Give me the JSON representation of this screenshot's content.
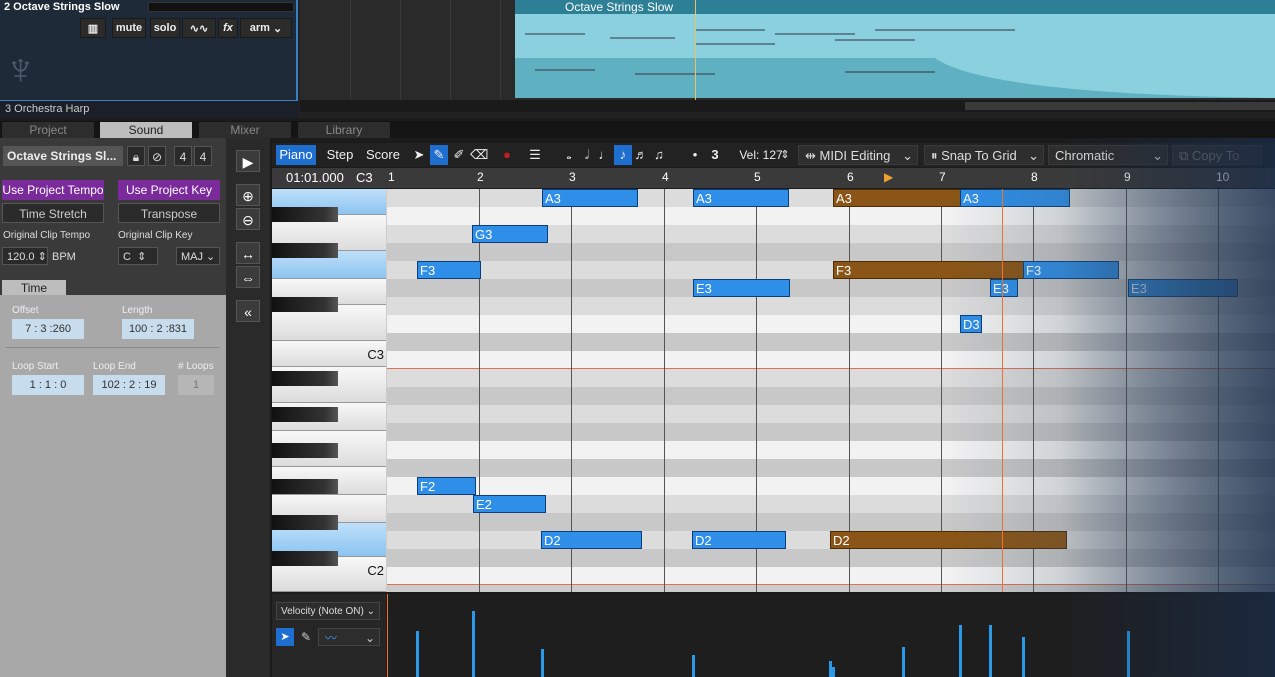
{
  "track2": {
    "name": "2 Octave Strings Slow",
    "buttons": [
      "mute",
      "solo",
      "fx",
      "arm"
    ]
  },
  "track3": {
    "name": "3 Orchestra Harp"
  },
  "clip": {
    "name": "Octave Strings Slow"
  },
  "tabs": [
    "Project",
    "Sound",
    "Mixer",
    "Library"
  ],
  "active_tab": "Sound",
  "left": {
    "clip_name": "Octave Strings Sl...",
    "time_sig_num": "4",
    "time_sig_den": "4",
    "use_project_tempo": "Use Project Tempo",
    "use_project_key": "Use Project Key",
    "time_stretch": "Time Stretch",
    "transpose": "Transpose",
    "orig_tempo_label": "Original Clip Tempo",
    "orig_key_label": "Original Clip Key",
    "tempo_value": "120.0",
    "bpm": "BPM",
    "key_value": "C",
    "mode_value": "MAJ",
    "time_tab": "Time",
    "offset_label": "Offset",
    "offset_value": "7 : 3 :260",
    "length_label": "Length",
    "length_value": "100 : 2 :831",
    "loop_start_label": "Loop Start",
    "loop_start_value": "1 : 1 : 0",
    "loop_end_label": "Loop End",
    "loop_end_value": "102 : 2 : 19",
    "loops_label": "# Loops",
    "loops_value": "1"
  },
  "toolbar": {
    "piano": "Piano",
    "step": "Step",
    "score": "Score",
    "triplet": "3",
    "vel_label": "Vel: 127",
    "midi_editing": "MIDI Editing",
    "snap": "Snap To Grid",
    "scale": "Chromatic",
    "copy_to": "Copy To"
  },
  "ruler": {
    "position": "01:01.000",
    "pitch": "C3",
    "bars": [
      "1",
      "2",
      "3",
      "4",
      "5",
      "6",
      "7",
      "8",
      "9",
      "10"
    ]
  },
  "keys": {
    "c3": "C3",
    "c2": "C2"
  },
  "notes": [
    {
      "label": "A3",
      "color": "blue"
    },
    {
      "label": "A3",
      "color": "blue"
    },
    {
      "label": "A3",
      "color": "brown"
    },
    {
      "label": "A3",
      "color": "blue"
    },
    {
      "label": "G3",
      "color": "blue"
    },
    {
      "label": "F3",
      "color": "blue"
    },
    {
      "label": "F3",
      "color": "brown"
    },
    {
      "label": "F3",
      "color": "blue"
    },
    {
      "label": "E3",
      "color": "blue"
    },
    {
      "label": "E3",
      "color": "blue"
    },
    {
      "label": "E3",
      "color": "blue"
    },
    {
      "label": "D3",
      "color": "blue"
    },
    {
      "label": "F2",
      "color": "blue"
    },
    {
      "label": "E2",
      "color": "blue"
    },
    {
      "label": "D2",
      "color": "blue"
    },
    {
      "label": "D2",
      "color": "blue"
    },
    {
      "label": "D2",
      "color": "brown"
    }
  ],
  "velocity": {
    "selector": "Velocity (Note ON)"
  }
}
